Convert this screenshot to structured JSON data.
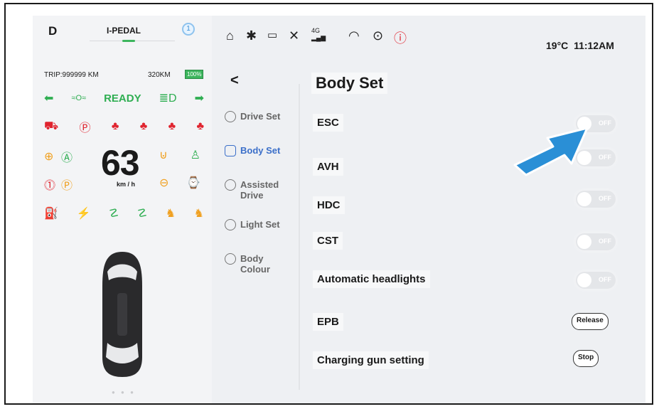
{
  "cluster": {
    "gear": "D",
    "ipedal": "I-PEDAL",
    "info_icon": "1",
    "trip": "TRIP:999999 KM",
    "range": "320KM",
    "battery": "100%",
    "ready": "READY",
    "speed": "63",
    "speed_unit": "km / h"
  },
  "status": {
    "temperature": "19°C",
    "time": "11:12AM",
    "network": "4G"
  },
  "page": {
    "back": "<",
    "title": "Body Set"
  },
  "menu": {
    "items": [
      {
        "label": "Drive Set"
      },
      {
        "label": "Body Set"
      },
      {
        "label": "Assisted Drive"
      },
      {
        "label": "Light Set"
      },
      {
        "label": "Body Colour"
      }
    ],
    "active": "Body Set"
  },
  "settings": {
    "items": [
      {
        "label": "ESC",
        "control": "toggle",
        "toggle_text": "OFF"
      },
      {
        "label": "AVH",
        "control": "toggle",
        "toggle_text": "OFF"
      },
      {
        "label": "HDC",
        "control": "toggle",
        "toggle_text": "OFF"
      },
      {
        "label": "CST",
        "control": "toggle",
        "toggle_text": "OFF"
      },
      {
        "label": "Automatic headlights",
        "control": "toggle",
        "toggle_text": "OFF"
      },
      {
        "label": "EPB",
        "control": "button",
        "button_text": "Release"
      },
      {
        "label": "Charging gun setting",
        "control": "button",
        "button_text": "Stop"
      }
    ]
  },
  "colors": {
    "accent": "#3b6fc9",
    "ready_green": "#2fae52",
    "warning_red": "#e0232e",
    "annotation_arrow": "#2a8fd6"
  }
}
